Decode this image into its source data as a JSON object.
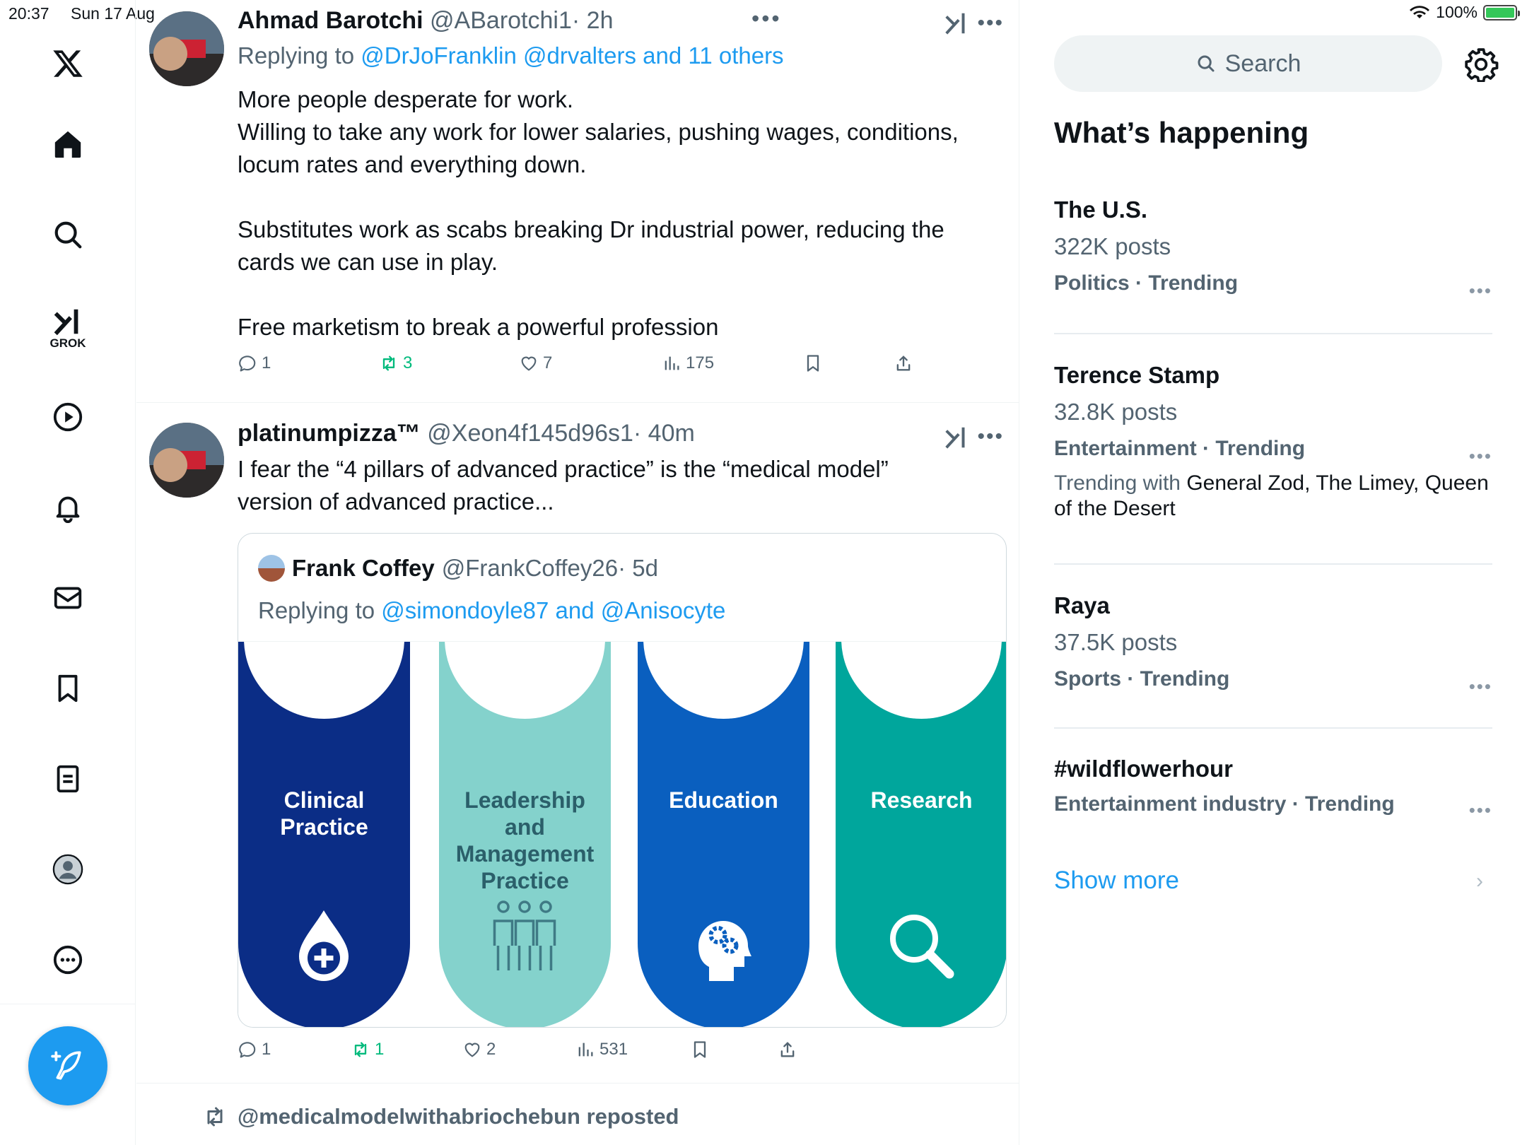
{
  "status": {
    "time": "20:37",
    "date": "Sun 17 Aug",
    "battery": "100%"
  },
  "nav": {
    "items": [
      "x-logo",
      "home",
      "explore",
      "grok",
      "video",
      "notifications",
      "messages",
      "bookmarks",
      "lists",
      "profile",
      "more"
    ],
    "grok_label": "GROK"
  },
  "tweets": [
    {
      "name": "Ahmad Barotchi",
      "handle": "@ABarotchi1",
      "time": "· 2h",
      "replying_prefix": "Replying to ",
      "replying_to": "@DrJoFranklin @drvalters and 11 others",
      "paragraphs": [
        "More people desperate for work.",
        "Willing to take any work for lower salaries, pushing wages, conditions, locum rates and everything down.",
        "",
        "Substitutes work as scabs breaking Dr industrial power, reducing the cards we can use in play.",
        "",
        "Free marketism to break a powerful profession"
      ],
      "replies": "1",
      "reposts": "3",
      "likes": "7",
      "views": "175"
    },
    {
      "name": "platinumpizza™",
      "handle": "@Xeon4f145d96s1",
      "time": "· 40m",
      "text_line1": "I fear the “4 pillars of advanced practice” is the “medical model”",
      "text_line2": "version of advanced practice...",
      "replies": "1",
      "reposts": "1",
      "likes": "2",
      "views": "531",
      "quote": {
        "name": "Frank Coffey",
        "handle": "@FrankCoffey26",
        "time": "· 5d",
        "replying_prefix": "Replying to ",
        "replying_to": "@simondoyle87 and @Anisocyte",
        "pillars": [
          {
            "label1": "Clinical",
            "label2": "Practice",
            "label3": "",
            "label4": "",
            "color": "#0b2d86",
            "text_color": "#ffffff",
            "icon": "drop-plus-icon"
          },
          {
            "label1": "Leadership",
            "label2": "and",
            "label3": "Management",
            "label4": "Practice",
            "color": "#84d2cc",
            "text_color": "#2b5f6a",
            "icon": "team-icon"
          },
          {
            "label1": "Education",
            "label2": "",
            "label3": "",
            "label4": "",
            "color": "#0a5fbf",
            "text_color": "#ffffff",
            "icon": "head-gears-icon"
          },
          {
            "label1": "Research",
            "label2": "",
            "label3": "",
            "label4": "",
            "color": "#00a69c",
            "text_color": "#ffffff",
            "icon": "magnifier-icon"
          }
        ]
      }
    }
  ],
  "repost_line": "@medicalmodelwithabriochebun reposted",
  "sidebar": {
    "search_placeholder": "Search",
    "heading": "What’s happening",
    "trends": [
      {
        "title": "The U.S.",
        "count": "322K posts",
        "category": "Politics · Trending"
      },
      {
        "title": "Terence Stamp",
        "count": "32.8K posts",
        "category": "Entertainment · Trending",
        "with_label": "Trending with ",
        "with_line1": "General Zod, The Limey, Queen",
        "with_line2": "of the Desert"
      },
      {
        "title": "Raya",
        "count": "37.5K posts",
        "category": "Sports · Trending"
      },
      {
        "title": "#wildflowerhour",
        "category": "Entertainment industry · Trending"
      }
    ],
    "show_more": "Show more"
  },
  "colors": {
    "accent": "#1d9bf0",
    "repost_green": "#00ba7c",
    "secondary_text": "#536471"
  }
}
